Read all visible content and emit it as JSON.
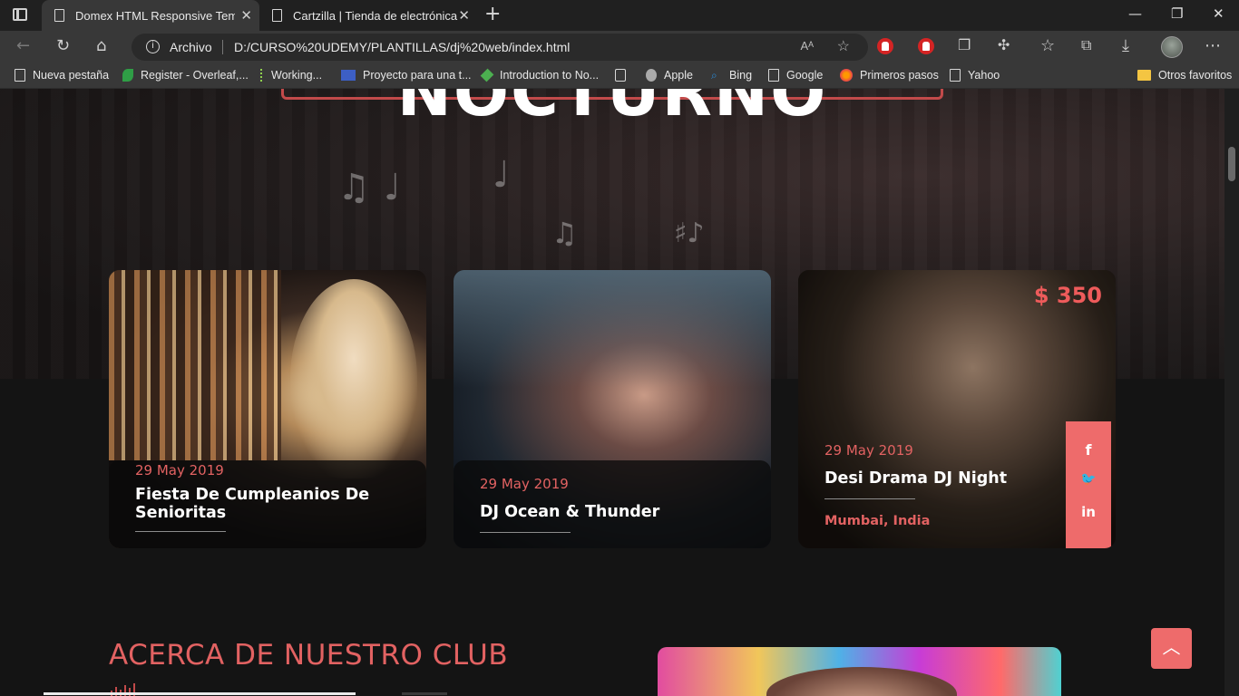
{
  "browser": {
    "tabs": [
      {
        "title": "Domex HTML Responsive Templa",
        "active": true
      },
      {
        "title": "Cartzilla | Tienda de electrónica",
        "active": false
      }
    ],
    "address": {
      "scheme_label": "Archivo",
      "url": "D:/CURSO%20UDEMY/PLANTILLAS/dj%20web/index.html"
    },
    "bookmarks": [
      {
        "label": "Nueva pestaña",
        "icon": "doc"
      },
      {
        "label": "Register - Overleaf,...",
        "icon": "leaf"
      },
      {
        "label": "Working...",
        "icon": "dot"
      },
      {
        "label": "Proyecto para una t...",
        "icon": "vb"
      },
      {
        "label": "Introduction to No...",
        "icon": "cube"
      },
      {
        "label": "",
        "icon": "cal"
      },
      {
        "label": "Apple",
        "icon": "apple"
      },
      {
        "label": "Bing",
        "icon": "bing"
      },
      {
        "label": "Google",
        "icon": "doc"
      },
      {
        "label": "Primeros pasos",
        "icon": "ff"
      },
      {
        "label": "Yahoo",
        "icon": "doc"
      }
    ],
    "other_favorites": "Otros favoritos",
    "text_size_icon": "Aᴬ"
  },
  "hero": {
    "title": "NOCTURNO"
  },
  "events": [
    {
      "date": "29 May 2019",
      "title": "Fiesta De Cumpleanios De Senioritas"
    },
    {
      "date": "29 May 2019",
      "title": "DJ Ocean & Thunder"
    },
    {
      "date": "29 May 2019",
      "title": "Desi Drama DJ Night",
      "price": "$ 350",
      "location": "Mumbai, India",
      "social": {
        "facebook": "f",
        "twitter": "🐦",
        "linkedin": "in"
      }
    }
  ],
  "about": {
    "heading": "ACERCA DE NUESTRO CLUB"
  },
  "colors": {
    "accent": "#ee6b6b",
    "accent_text": "#e26262",
    "background": "#141414"
  }
}
